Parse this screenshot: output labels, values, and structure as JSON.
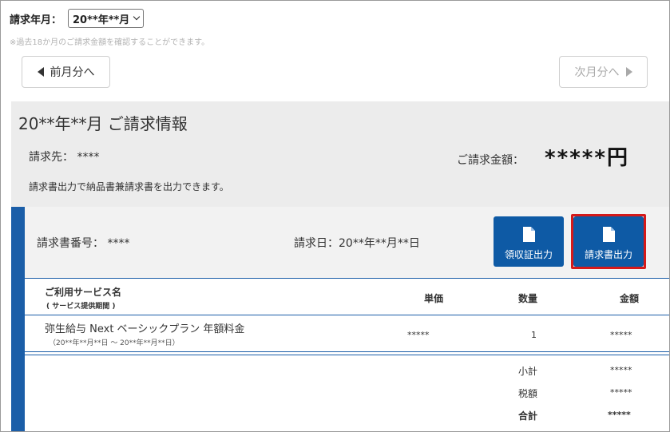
{
  "header": {
    "month_label": "請求年月：",
    "month_value": "20**年**月",
    "note": "※過去18か月のご請求金額を確認することができます。"
  },
  "nav": {
    "prev_label": "前月分へ",
    "next_label": "次月分へ"
  },
  "summary": {
    "title": "20**年**月 ご請求情報",
    "billto": "請求先：  ****",
    "amount_label": "ご請求金額：",
    "amount_value": "*****円",
    "note": "請求書出力で納品書兼請求書を出力できます。"
  },
  "invoice": {
    "number": "請求書番号：  ****",
    "date": "請求日：20**年**月**日",
    "receipt_button": "領収証出力",
    "invoice_button": "請求書出力"
  },
  "table": {
    "headers": {
      "service": "ご利用サービス名",
      "service_sub": "( サービス提供期間 )",
      "unit_price": "単価",
      "quantity": "数量",
      "amount": "金額"
    },
    "rows": [
      {
        "name": "弥生給与 Next ベーシックプラン 年額料金",
        "period": "（20**年**月**日 ～ 20**年**月**日）",
        "unit_price": "*****",
        "quantity": "1",
        "amount": "*****"
      }
    ],
    "totals": {
      "subtotal_label": "小計",
      "subtotal_value": "*****",
      "tax_label": "税額",
      "tax_value": "*****",
      "total_label": "合計",
      "total_value": "*****"
    }
  },
  "colors": {
    "accent": "#1b5ea8",
    "button": "#0e5aa5",
    "highlight": "#d51a1a",
    "panel": "#ececec"
  },
  "icons": {
    "prev": "triangle-left-icon",
    "next": "triangle-right-icon",
    "doc": "document-icon"
  }
}
